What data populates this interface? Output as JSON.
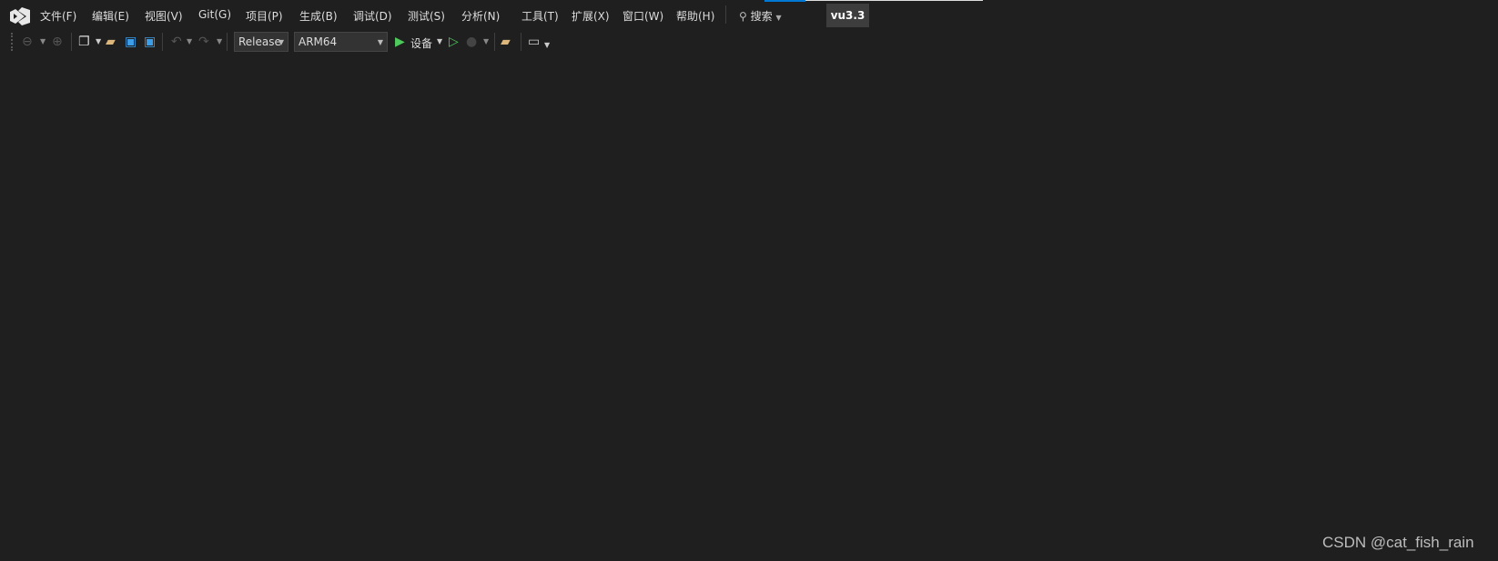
{
  "menu": [
    "文件(F)",
    "编辑(E)",
    "视图(V)",
    "Git(G)",
    "项目(P)",
    "生成(B)",
    "调试(D)",
    "测试(S)",
    "分析(N)",
    "工具(T)",
    "扩展(X)",
    "窗口(W)",
    "帮助(H)"
  ],
  "search": {
    "label": "搜索"
  },
  "solution_badge": "vu3.3",
  "toolbar": {
    "configuration": "Release",
    "platform": "ARM64",
    "run_label": "设备"
  },
  "watermark": "CSDN @cat_fish_rain",
  "colors": {
    "background": "#1f1f1f",
    "accent": "#0078d4",
    "run_green": "#4ec95b"
  }
}
